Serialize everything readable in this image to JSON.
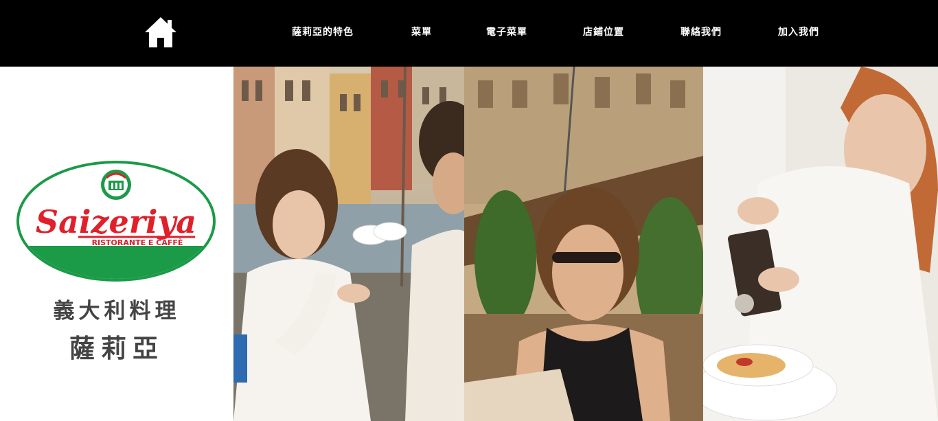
{
  "header": {
    "home_icon": "home-icon",
    "nav": [
      {
        "label": "薩莉亞的特色"
      },
      {
        "label": "菜單"
      },
      {
        "label": "電子菜單"
      },
      {
        "label": "店鋪位置"
      },
      {
        "label": "聯絡我們"
      },
      {
        "label": "加入我們"
      }
    ],
    "background_color": "#000000",
    "text_color": "#ffffff"
  },
  "brand": {
    "logo_text": "Saizeriya",
    "logo_subtext": "RISTORANTE E CAFFÈ",
    "tagline_line1": "義大利料理",
    "tagline_line2": "薩莉亞",
    "logo_colors": {
      "red": "#e0202a",
      "green": "#1b9a48"
    }
  },
  "gallery": [
    {
      "subject": "woman toasting with espresso cup at harbor cafe"
    },
    {
      "subject": "smiling woman with sunglasses at outdoor cafe"
    },
    {
      "subject": "chef grinding pepper over pasta"
    }
  ]
}
